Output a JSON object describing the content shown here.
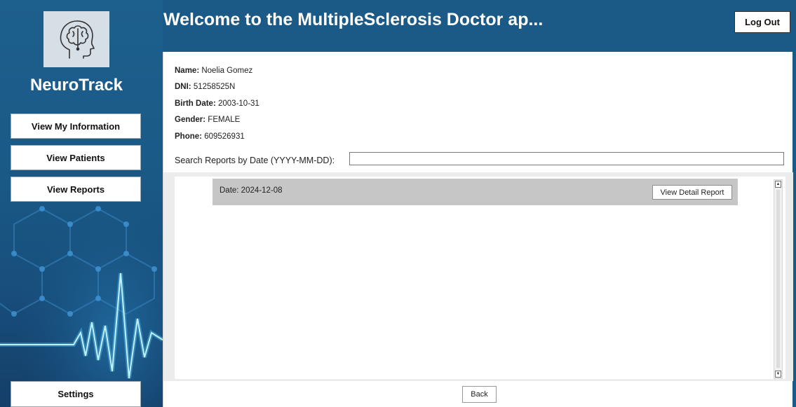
{
  "app": {
    "name": "NeuroTrack",
    "logo_icon": "brain-head-icon",
    "accent_color": "#1b5a86"
  },
  "header": {
    "title": "Welcome to the MultipleSclerosis Doctor ap...",
    "logout_label": "Log Out"
  },
  "sidebar": {
    "items": [
      {
        "label": "View My Information"
      },
      {
        "label": "View Patients"
      },
      {
        "label": "View Reports"
      }
    ],
    "settings_label": "Settings",
    "background_art": "heartbeat-hexagon-graphic"
  },
  "profile": {
    "name_label": "Name:",
    "name": "Noelia Gomez",
    "dni_label": "DNI:",
    "dni": "51258525N",
    "birth_label": "Birth Date:",
    "birth": "2003-10-31",
    "gender_label": "Gender:",
    "gender": "FEMALE",
    "phone_label": "Phone:",
    "phone": "609526931"
  },
  "search": {
    "label": "Search Reports by Date (YYYY-MM-DD):",
    "value": ""
  },
  "reports": [
    {
      "date_text": "Date: 2024-12-08",
      "button_label": "View Detail Report"
    }
  ],
  "footer": {
    "back_label": "Back"
  }
}
